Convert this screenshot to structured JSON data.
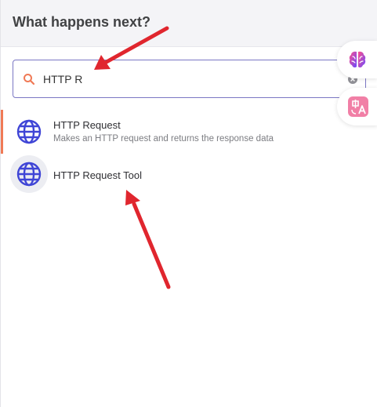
{
  "header": {
    "title": "What happens next?"
  },
  "search": {
    "value": "HTTP R",
    "icon": "search-icon",
    "clear_icon": "clear-icon"
  },
  "side_buttons": [
    {
      "icon": "brain-icon"
    },
    {
      "icon": "translate-icon"
    }
  ],
  "results": [
    {
      "title": "HTTP Request",
      "description": "Makes an HTTP request and returns the response data",
      "icon": "globe-icon",
      "selected": true
    },
    {
      "title": "HTTP Request Tool",
      "description": "",
      "icon": "globe-icon",
      "hovered": true
    }
  ],
  "colors": {
    "accent_border": "#f07a56",
    "search_border": "#7b77c4",
    "globe": "#3f45d6",
    "annotation_arrow": "#e0262e"
  }
}
